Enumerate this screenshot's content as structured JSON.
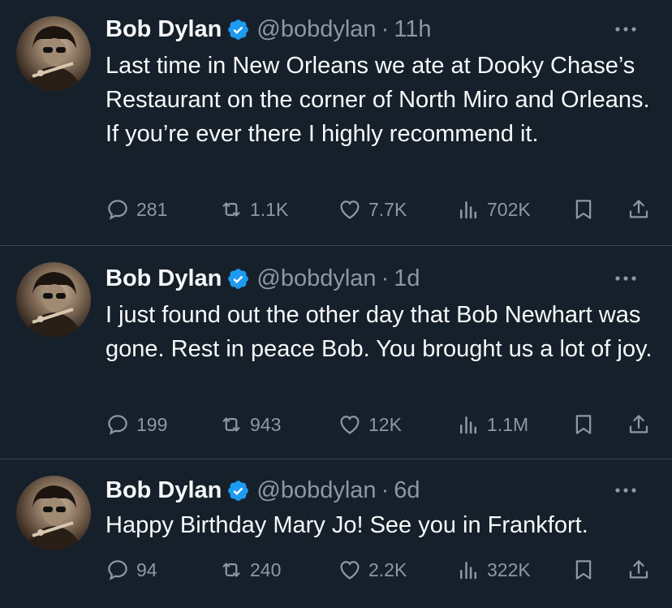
{
  "tweets": [
    {
      "author": {
        "name": "Bob Dylan",
        "handle": "@bobdylan",
        "verified": true
      },
      "time": "11h",
      "text": "Last time in New Orleans we ate at Dooky Chase’s Restaurant on the corner of North Miro and Orleans. If you’re ever there I highly recommend it.",
      "stats": {
        "replies": "281",
        "reposts": "1.1K",
        "likes": "7.7K",
        "views": "702K"
      }
    },
    {
      "author": {
        "name": "Bob Dylan",
        "handle": "@bobdylan",
        "verified": true
      },
      "time": "1d",
      "text": "I just found out the other day that Bob Newhart was gone. Rest in peace Bob. You brought us a lot of joy.",
      "stats": {
        "replies": "199",
        "reposts": "943",
        "likes": "12K",
        "views": "1.1M"
      }
    },
    {
      "author": {
        "name": "Bob Dylan",
        "handle": "@bobdylan",
        "verified": true
      },
      "time": "6d",
      "text": "Happy Birthday Mary Jo! See you in Frankfort.",
      "stats": {
        "replies": "94",
        "reposts": "240",
        "likes": "2.2K",
        "views": "322K"
      }
    }
  ],
  "separator": "·",
  "colors": {
    "background": "#15202b",
    "text": "#f7f9f9",
    "muted": "#8b98a5",
    "border": "#38444d",
    "verified": "#1d9bf0"
  }
}
